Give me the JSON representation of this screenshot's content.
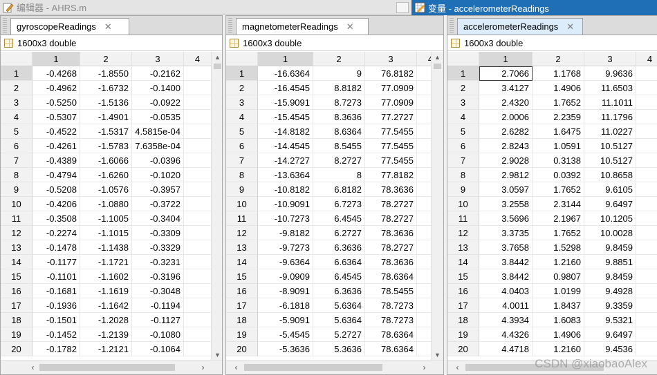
{
  "editor_title": "编辑器 - AHRS.m",
  "variables_title": "变量 - accelerometerReadings",
  "watermark": "CSDN @xiaobaoAlex",
  "panels": [
    {
      "tab": "gyroscopeReadings",
      "info": "1600x3 double",
      "columns": [
        "1",
        "2",
        "3",
        "4"
      ],
      "rows": [
        [
          "1",
          "-0.4268",
          "-1.8550",
          "-0.2162"
        ],
        [
          "2",
          "-0.4962",
          "-1.6732",
          "-0.1400"
        ],
        [
          "3",
          "-0.5250",
          "-1.5136",
          "-0.0922"
        ],
        [
          "4",
          "-0.5307",
          "-1.4901",
          "-0.0535"
        ],
        [
          "5",
          "-0.4522",
          "-1.5317",
          "4.5815e-04"
        ],
        [
          "6",
          "-0.4261",
          "-1.5783",
          "7.6358e-04"
        ],
        [
          "7",
          "-0.4389",
          "-1.6066",
          "-0.0396"
        ],
        [
          "8",
          "-0.4794",
          "-1.6260",
          "-0.1020"
        ],
        [
          "9",
          "-0.5208",
          "-1.0576",
          "-0.3957"
        ],
        [
          "10",
          "-0.4206",
          "-1.0880",
          "-0.3722"
        ],
        [
          "11",
          "-0.3508",
          "-1.1005",
          "-0.3404"
        ],
        [
          "12",
          "-0.2274",
          "-1.1015",
          "-0.3309"
        ],
        [
          "13",
          "-0.1478",
          "-1.1438",
          "-0.3329"
        ],
        [
          "14",
          "-0.1177",
          "-1.1721",
          "-0.3231"
        ],
        [
          "15",
          "-0.1101",
          "-1.1602",
          "-0.3196"
        ],
        [
          "16",
          "-0.1681",
          "-1.1619",
          "-0.3048"
        ],
        [
          "17",
          "-0.1936",
          "-1.1642",
          "-0.1194"
        ],
        [
          "18",
          "-0.1501",
          "-1.2028",
          "-0.1127"
        ],
        [
          "19",
          "-0.1452",
          "-1.2139",
          "-0.1080"
        ],
        [
          "20",
          "-0.1782",
          "-1.2121",
          "-0.1064"
        ]
      ]
    },
    {
      "tab": "magnetometerReadings",
      "info": "1600x3 double",
      "columns": [
        "1",
        "2",
        "3",
        "4"
      ],
      "rows": [
        [
          "1",
          "-16.6364",
          "9",
          "76.8182"
        ],
        [
          "2",
          "-16.4545",
          "8.8182",
          "77.0909"
        ],
        [
          "3",
          "-15.9091",
          "8.7273",
          "77.0909"
        ],
        [
          "4",
          "-15.4545",
          "8.3636",
          "77.2727"
        ],
        [
          "5",
          "-14.8182",
          "8.6364",
          "77.5455"
        ],
        [
          "6",
          "-14.4545",
          "8.5455",
          "77.5455"
        ],
        [
          "7",
          "-14.2727",
          "8.2727",
          "77.5455"
        ],
        [
          "8",
          "-13.6364",
          "8",
          "77.8182"
        ],
        [
          "9",
          "-10.8182",
          "6.8182",
          "78.3636"
        ],
        [
          "10",
          "-10.9091",
          "6.7273",
          "78.2727"
        ],
        [
          "11",
          "-10.7273",
          "6.4545",
          "78.2727"
        ],
        [
          "12",
          "-9.8182",
          "6.2727",
          "78.3636"
        ],
        [
          "13",
          "-9.7273",
          "6.3636",
          "78.2727"
        ],
        [
          "14",
          "-9.6364",
          "6.6364",
          "78.3636"
        ],
        [
          "15",
          "-9.0909",
          "6.4545",
          "78.6364"
        ],
        [
          "16",
          "-8.9091",
          "6.3636",
          "78.5455"
        ],
        [
          "17",
          "-6.1818",
          "5.6364",
          "78.7273"
        ],
        [
          "18",
          "-5.9091",
          "5.6364",
          "78.7273"
        ],
        [
          "19",
          "-5.4545",
          "5.2727",
          "78.6364"
        ],
        [
          "20",
          "-5.3636",
          "5.3636",
          "78.6364"
        ]
      ]
    },
    {
      "tab": "accelerometerReadings",
      "info": "1600x3 double",
      "columns": [
        "1",
        "2",
        "3",
        "4"
      ],
      "rows": [
        [
          "1",
          "2.7066",
          "1.1768",
          "9.9636"
        ],
        [
          "2",
          "3.4127",
          "1.4906",
          "11.6503"
        ],
        [
          "3",
          "2.4320",
          "1.7652",
          "11.1011"
        ],
        [
          "4",
          "2.0006",
          "2.2359",
          "11.1796"
        ],
        [
          "5",
          "2.6282",
          "1.6475",
          "11.0227"
        ],
        [
          "6",
          "2.8243",
          "1.0591",
          "10.5127"
        ],
        [
          "7",
          "2.9028",
          "0.3138",
          "10.5127"
        ],
        [
          "8",
          "2.9812",
          "0.0392",
          "10.8658"
        ],
        [
          "9",
          "3.0597",
          "1.7652",
          "9.6105"
        ],
        [
          "10",
          "3.2558",
          "2.3144",
          "9.6497"
        ],
        [
          "11",
          "3.5696",
          "2.1967",
          "10.1205"
        ],
        [
          "12",
          "3.3735",
          "1.7652",
          "10.0028"
        ],
        [
          "13",
          "3.7658",
          "1.5298",
          "9.8459"
        ],
        [
          "14",
          "3.8442",
          "1.2160",
          "9.8851"
        ],
        [
          "15",
          "3.8442",
          "0.9807",
          "9.8459"
        ],
        [
          "16",
          "4.0403",
          "1.0199",
          "9.4928"
        ],
        [
          "17",
          "4.0011",
          "1.8437",
          "9.3359"
        ],
        [
          "18",
          "4.3934",
          "1.6083",
          "9.5321"
        ],
        [
          "19",
          "4.4326",
          "1.4906",
          "9.6497"
        ],
        [
          "20",
          "4.4718",
          "1.2160",
          "9.4536"
        ]
      ]
    }
  ]
}
